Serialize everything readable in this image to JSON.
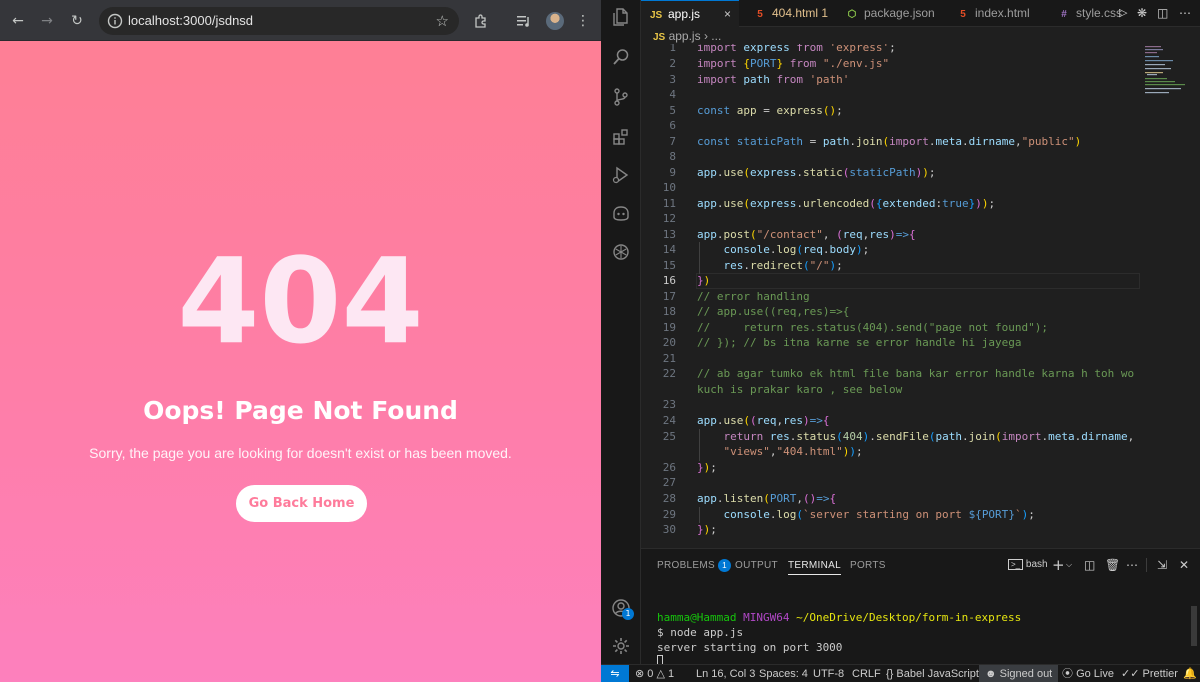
{
  "browser": {
    "url": "localhost:3000/jsdnsd",
    "page": {
      "code": "404",
      "heading": "Oops! Page Not Found",
      "message": "Sorry, the page you are looking for doesn't exist or has been moved.",
      "button_label": "Go Back Home"
    }
  },
  "vscode": {
    "tabs": [
      {
        "label": "app.js",
        "icon": "js-icon",
        "active": true
      },
      {
        "label": "404.html",
        "badge": "1",
        "icon": "html-icon"
      },
      {
        "label": "package.json",
        "icon": "nodejs-icon"
      },
      {
        "label": "index.html",
        "icon": "html-icon"
      },
      {
        "label": "style.css",
        "icon": "css-icon"
      }
    ],
    "breadcrumb": {
      "file": "app.js",
      "rest": "..."
    },
    "line_numbers": [
      "1",
      "2",
      "3",
      "4",
      "5",
      "6",
      "7",
      "8",
      "9",
      "10",
      "11",
      "12",
      "13",
      "14",
      "15",
      "16",
      "17",
      "18",
      "19",
      "20",
      "21",
      "22",
      "",
      "23",
      "24",
      "25",
      "",
      "26",
      "27",
      "28",
      "29",
      "30"
    ],
    "current_line": "16",
    "panel": {
      "tabs": [
        "PROBLEMS",
        "OUTPUT",
        "TERMINAL",
        "PORTS"
      ],
      "problems_count": "1",
      "active_tab": "TERMINAL",
      "shell": "bash",
      "terminal": {
        "user": "hamma@Hammad",
        "env": "MINGW64",
        "path": "~/OneDrive/Desktop/form-in-express",
        "command": "$ node app.js",
        "output": "server starting on port 3000"
      }
    },
    "statusbar": {
      "errors": "0",
      "warnings": "1",
      "position": "Ln 16, Col 3",
      "spaces": "Spaces: 4",
      "encoding": "UTF-8",
      "eol": "CRLF",
      "language": "Babel JavaScript",
      "account": "Signed out",
      "live": "Go Live",
      "formatter": "Prettier"
    },
    "colors": {
      "accent": "#0078d4",
      "editor_bg": "#1f1f1f",
      "page_pink": "#fe7ea8"
    }
  }
}
